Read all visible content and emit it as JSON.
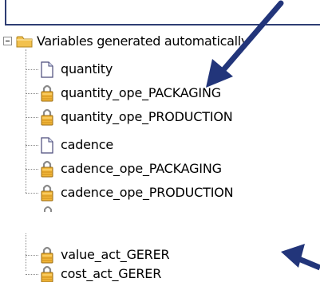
{
  "tree": {
    "root_label": "Variables generated automatically",
    "items": [
      {
        "label": "quantity",
        "icon": "document-icon"
      },
      {
        "label": "quantity_ope_PACKAGING",
        "icon": "lock-icon"
      },
      {
        "label": "quantity_ope_PRODUCTION",
        "icon": "lock-icon"
      },
      {
        "label": "cadence",
        "icon": "document-icon"
      },
      {
        "label": "cadence_ope_PACKAGING",
        "icon": "lock-icon"
      },
      {
        "label": "cadence_ope_PRODUCTION",
        "icon": "lock-icon"
      },
      {
        "label": "value_act_GERER",
        "icon": "lock-icon"
      },
      {
        "label": "cost_act_GERER",
        "icon": "lock-icon"
      }
    ]
  },
  "colors": {
    "arrow": "#22357a",
    "folder": "#f2c14e",
    "lock_body": "#f0b63a",
    "dotted_line": "#8a8a8a"
  }
}
